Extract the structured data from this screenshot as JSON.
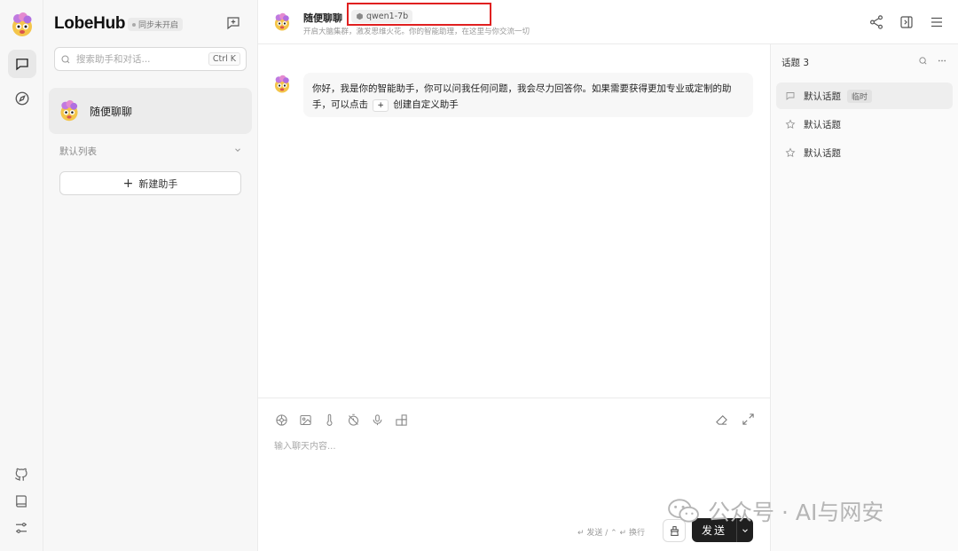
{
  "app": {
    "brand": "LobeHub",
    "sync_status": "同步未开启"
  },
  "search": {
    "placeholder": "搜索助手和对话...",
    "shortcut": "Ctrl K"
  },
  "sidebar": {
    "sessions": [
      {
        "name": "随便聊聊"
      }
    ],
    "group_title": "默认列表",
    "new_assistant_label": "新建助手"
  },
  "chat": {
    "title": "随便聊聊",
    "model": "qwen1-7b",
    "description": "开启大脑集群，激发思维火花。你的智能助理，在这里与你交流一切",
    "messages": [
      {
        "role": "assistant",
        "text_before": "你好，我是你的智能助手，你可以问我任何问题，我会尽力回答你。如果需要获得更加专业或定制的助手，可以点击",
        "inline_key": "+",
        "text_after": "创建自定义助手"
      }
    ]
  },
  "input": {
    "placeholder": "输入聊天内容...",
    "send_hint": "↵ 发送 / ⌃ ↵ 换行",
    "send_label": "发送"
  },
  "topics": {
    "title": "话题 3",
    "items": [
      {
        "label": "默认话题",
        "badge": "临时",
        "active": true
      },
      {
        "label": "默认话题",
        "badge": "",
        "active": false
      },
      {
        "label": "默认话题",
        "badge": "",
        "active": false
      }
    ]
  },
  "watermark": {
    "text": "公众号 · AI与网安"
  },
  "colors": {
    "accent": "#1f1f1f",
    "highlight": "#e02020"
  }
}
